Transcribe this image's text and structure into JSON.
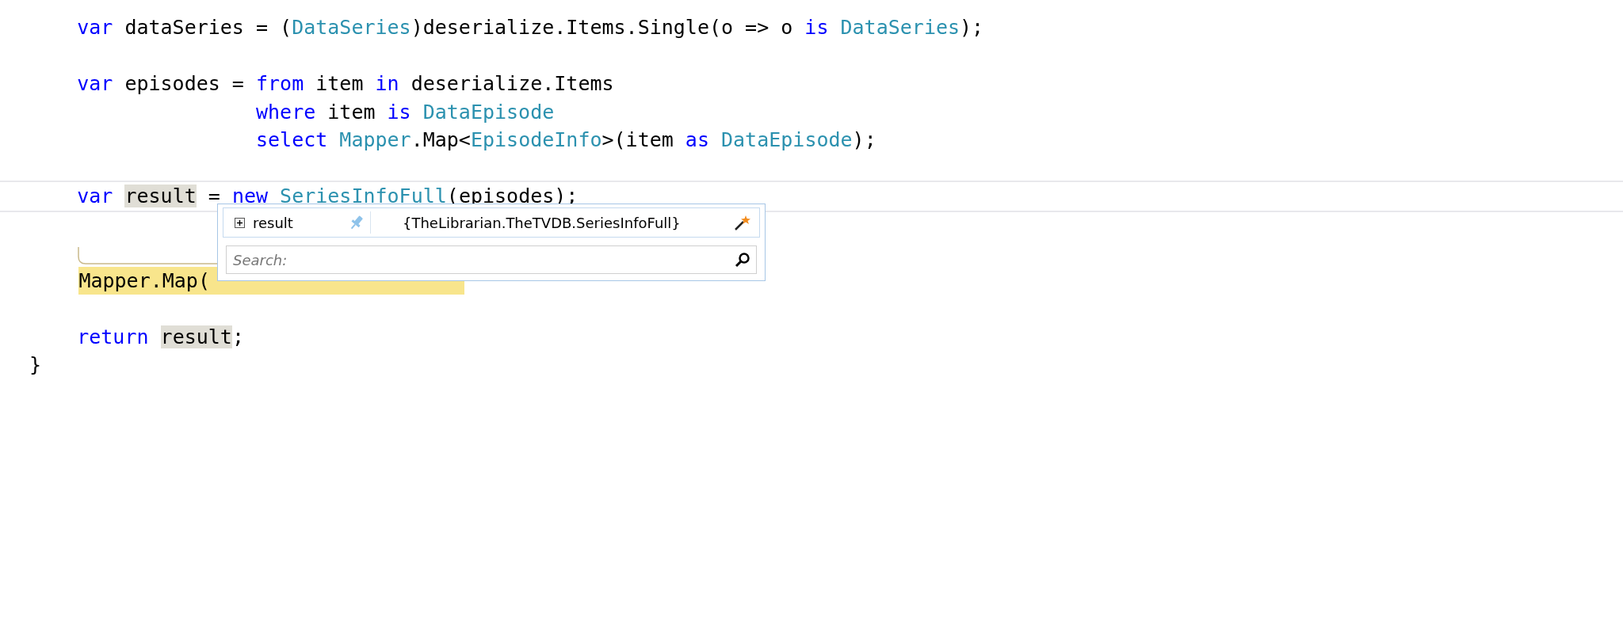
{
  "code_lines": [
    {
      "kind": "plain",
      "tokens": [
        {
          "kind": "kw",
          "text": "    var"
        },
        {
          "kind": "text",
          "text": " dataSeries = ("
        },
        {
          "kind": "type",
          "text": "DataSeries"
        },
        {
          "kind": "text",
          "text": ")deserialize.Items.Single(o => o "
        },
        {
          "kind": "kw",
          "text": "is"
        },
        {
          "kind": "type",
          "text": " DataSeries"
        },
        {
          "kind": "text",
          "text": ");"
        }
      ]
    },
    {
      "kind": "blank"
    },
    {
      "kind": "plain",
      "tokens": [
        {
          "kind": "kw",
          "text": "    var"
        },
        {
          "kind": "text",
          "text": " episodes = "
        },
        {
          "kind": "kw",
          "text": "from"
        },
        {
          "kind": "text",
          "text": " item "
        },
        {
          "kind": "kw",
          "text": "in"
        },
        {
          "kind": "text",
          "text": " deserialize.Items"
        }
      ]
    },
    {
      "kind": "plain",
      "tokens": [
        {
          "kind": "kw",
          "text": "                   where"
        },
        {
          "kind": "text",
          "text": " item "
        },
        {
          "kind": "kw",
          "text": "is"
        },
        {
          "kind": "type",
          "text": " DataEpisode"
        }
      ]
    },
    {
      "kind": "plain",
      "tokens": [
        {
          "kind": "kw",
          "text": "                   select"
        },
        {
          "kind": "type",
          "text": " Mapper"
        },
        {
          "kind": "text",
          "text": ".Map<"
        },
        {
          "kind": "type",
          "text": "EpisodeInfo"
        },
        {
          "kind": "text",
          "text": ">(item "
        },
        {
          "kind": "kw",
          "text": "as"
        },
        {
          "kind": "type",
          "text": " DataEpisode"
        },
        {
          "kind": "text",
          "text": ");"
        }
      ]
    },
    {
      "kind": "blank"
    },
    {
      "kind": "current",
      "tokens": [
        {
          "kind": "kw",
          "text": "    var "
        },
        {
          "kind": "ref",
          "text": "result"
        },
        {
          "kind": "text",
          "text": " = "
        },
        {
          "kind": "kw",
          "text": "new"
        },
        {
          "kind": "type",
          "text": " SeriesInfoFull"
        },
        {
          "kind": "text",
          "text": "(episodes);"
        }
      ]
    },
    {
      "kind": "blank"
    },
    {
      "kind": "blank"
    },
    {
      "kind": "marked",
      "tokens": [
        {
          "kind": "text",
          "text": "Mapper.Map("
        }
      ]
    },
    {
      "kind": "blank"
    },
    {
      "kind": "plain",
      "tokens": [
        {
          "kind": "kw",
          "text": "    return "
        },
        {
          "kind": "ref",
          "text": "result"
        },
        {
          "kind": "text",
          "text": ";"
        }
      ]
    },
    {
      "kind": "plain",
      "tokens": [
        {
          "kind": "text",
          "text": "}"
        }
      ]
    }
  ],
  "datatip": {
    "name": "result",
    "value": "{TheLibrarian.TheTVDB.SeriesInfoFull}",
    "expanded": false,
    "pinned": false,
    "search": {
      "placeholder": "Search:"
    }
  }
}
